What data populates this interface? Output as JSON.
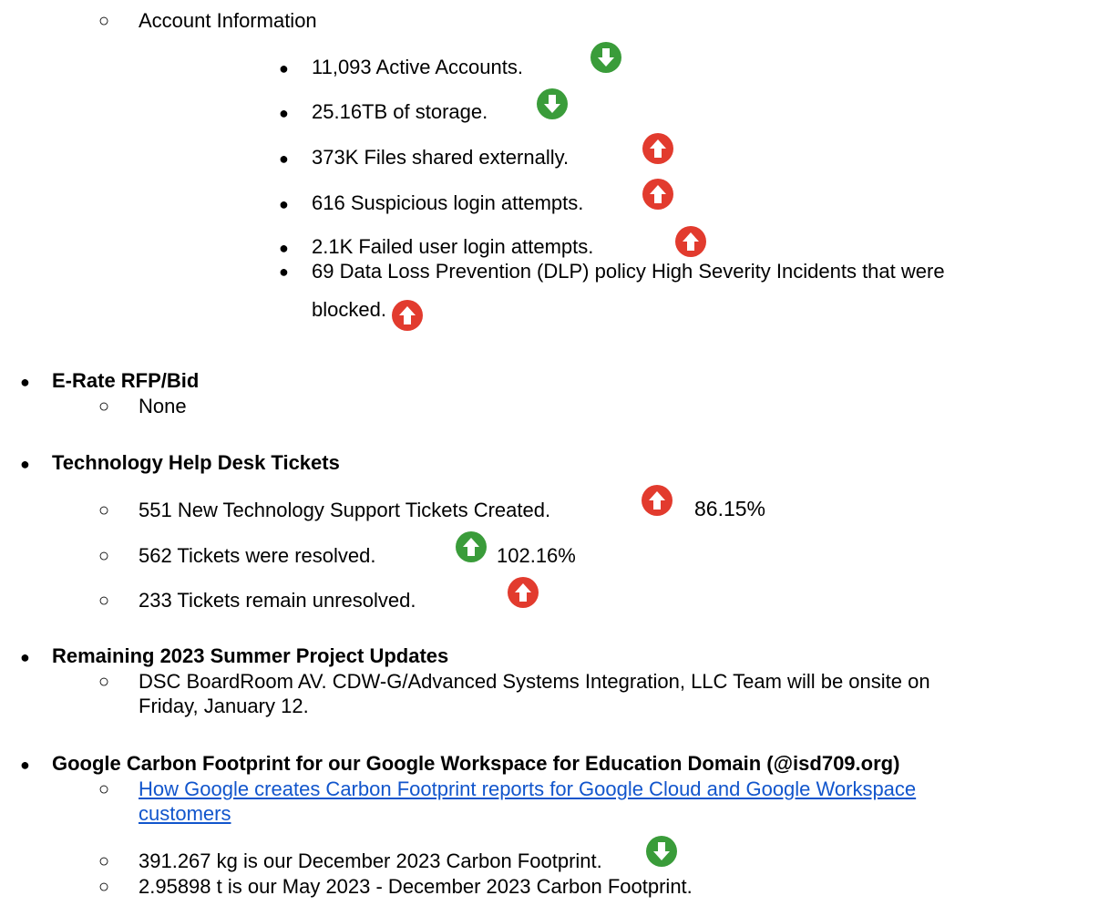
{
  "colors": {
    "down": "#3a9c3a",
    "up_red": "#e23b2e",
    "up_green": "#3a9c3a",
    "link": "#1155cc"
  },
  "account": {
    "heading": "Account Information",
    "items": [
      {
        "text": "11,093 Active Accounts.",
        "icon": "arrow-down-icon"
      },
      {
        "text": "25.16TB of storage.",
        "icon": "arrow-down-icon"
      },
      {
        "text": "373K Files shared externally.",
        "icon": "arrow-up-icon"
      },
      {
        "text": "616 Suspicious login attempts.",
        "icon": "arrow-up-icon"
      },
      {
        "text": "2.1K Failed user login attempts.",
        "icon": "arrow-up-icon"
      },
      {
        "text_line1": "69 Data Loss Prevention (DLP) policy High Severity Incidents that were",
        "text_line2": "blocked.",
        "icon": "arrow-up-icon"
      }
    ]
  },
  "erate": {
    "heading": "E-Rate RFP/Bid",
    "items": [
      "None"
    ]
  },
  "helpdesk": {
    "heading": "Technology Help Desk Tickets",
    "items": [
      {
        "text": "551 New Technology Support Tickets Created.",
        "icon": "arrow-up-icon",
        "percent": "86.15%"
      },
      {
        "text": "562 Tickets were resolved.",
        "icon": "arrow-up-icon",
        "percent": "102.16%"
      },
      {
        "text": "233  Tickets remain unresolved.",
        "icon": "arrow-up-icon"
      }
    ]
  },
  "summer": {
    "heading": "Remaining 2023 Summer Project Updates",
    "item_line1": "DSC BoardRoom AV.  CDW-G/Advanced Systems Integration, LLC Team will be onsite on",
    "item_line2": "Friday, January 12."
  },
  "carbon": {
    "heading": "Google Carbon Footprint for our Google Workspace for Education Domain (@isd709.org)",
    "link_line1": "How Google creates Carbon Footprint reports for Google Cloud and Google Workspace",
    "link_line2": "customers",
    "items": [
      {
        "text": "391.267 kg is our December 2023 Carbon Footprint.",
        "icon": "arrow-down-icon"
      },
      {
        "text": "2.95898 t  is our May 2023 - December 2023 Carbon Footprint."
      }
    ]
  }
}
